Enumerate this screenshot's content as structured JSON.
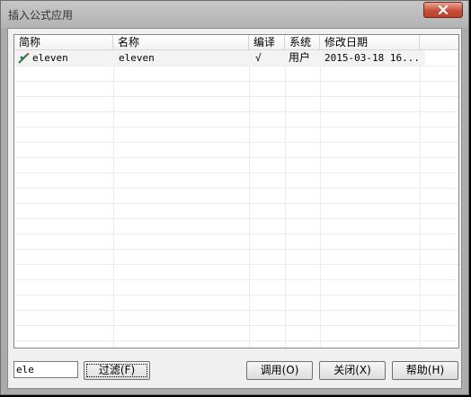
{
  "window": {
    "title": "插入公式应用"
  },
  "table": {
    "columns": [
      "简称",
      "名称",
      "编译",
      "系统",
      "修改日期"
    ],
    "rows": [
      {
        "short_name": "eleven",
        "name": "eleven",
        "compiled": "√",
        "system": "用户",
        "modified": "2015-03-18 16..."
      }
    ]
  },
  "filter": {
    "value": "ele"
  },
  "buttons": {
    "filter": "过滤(F)",
    "invoke": "调用(O)",
    "close": "关闭(X)",
    "help": "帮助(H)"
  },
  "icons": {
    "close": "close-x-icon",
    "formula": "formula-pencil-icon"
  }
}
